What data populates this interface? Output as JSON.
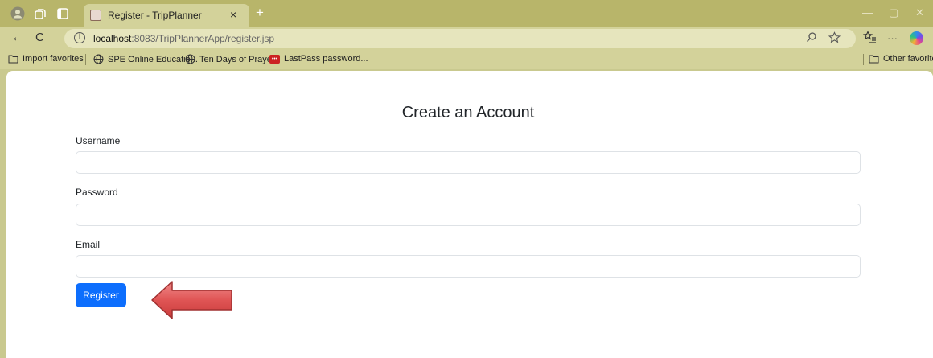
{
  "browser": {
    "tab": {
      "title": "Register - TripPlanner",
      "close_glyph": "×"
    },
    "new_tab_glyph": "+",
    "window_controls": {
      "minimize": "—",
      "restore": "▢",
      "close": "✕"
    },
    "nav": {
      "back": "←",
      "refresh": "C"
    },
    "address": {
      "info_glyph": "i",
      "host": "localhost",
      "path": ":8083/TripPlannerApp/register.jsp"
    },
    "toolbar": {
      "more": "···"
    },
    "favorites": {
      "import": "Import favorites",
      "items": [
        "SPE Online Educatio...",
        "Ten Days of Prayer",
        "LastPass password..."
      ],
      "lastpass_icon_text": "•••",
      "other": "Other favorites"
    }
  },
  "form": {
    "title": "Create an Account",
    "username_label": "Username",
    "username_value": "",
    "password_label": "Password",
    "password_value": "",
    "email_label": "Email",
    "email_value": "",
    "register_button": "Register"
  },
  "colors": {
    "accent": "#0d6efd",
    "browser_chrome": "#d3d29a",
    "tab_strip": "#b8b56a",
    "arrow": "#e05555"
  },
  "icons": [
    "profile-icon",
    "workspaces-icon",
    "tab-actions-icon",
    "search-icon",
    "star-icon",
    "favorites-icon",
    "globe-icon",
    "folder-icon"
  ]
}
